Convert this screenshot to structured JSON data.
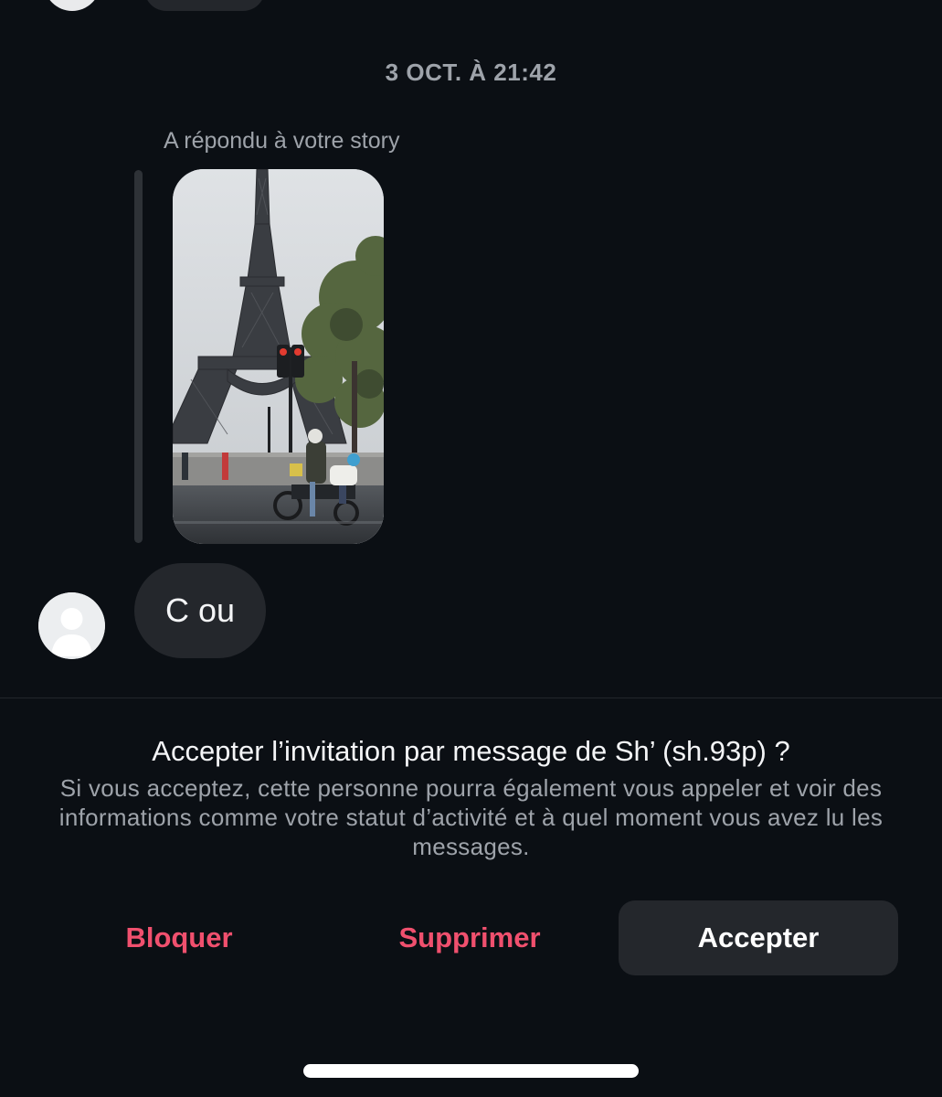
{
  "conversation": {
    "timestamp": "3 OCT. À 21:42",
    "reply_caption": "A répondu à votre story",
    "story_image": "eiffel-tower-photo",
    "message_text": "C ou"
  },
  "invitation": {
    "title": "Accepter l’invitation par message de Sh’ (sh.93p) ?",
    "description": "Si vous acceptez, cette personne pourra également vous appeler et voir des informations comme votre statut d’activité et à quel moment vous avez lu les messages."
  },
  "actions": {
    "block_label": "Bloquer",
    "delete_label": "Supprimer",
    "accept_label": "Accepter"
  },
  "colors": {
    "background": "#0b0f14",
    "bubble": "#24272c",
    "destructive": "#f0506e",
    "muted_text": "#9ea3aa"
  }
}
